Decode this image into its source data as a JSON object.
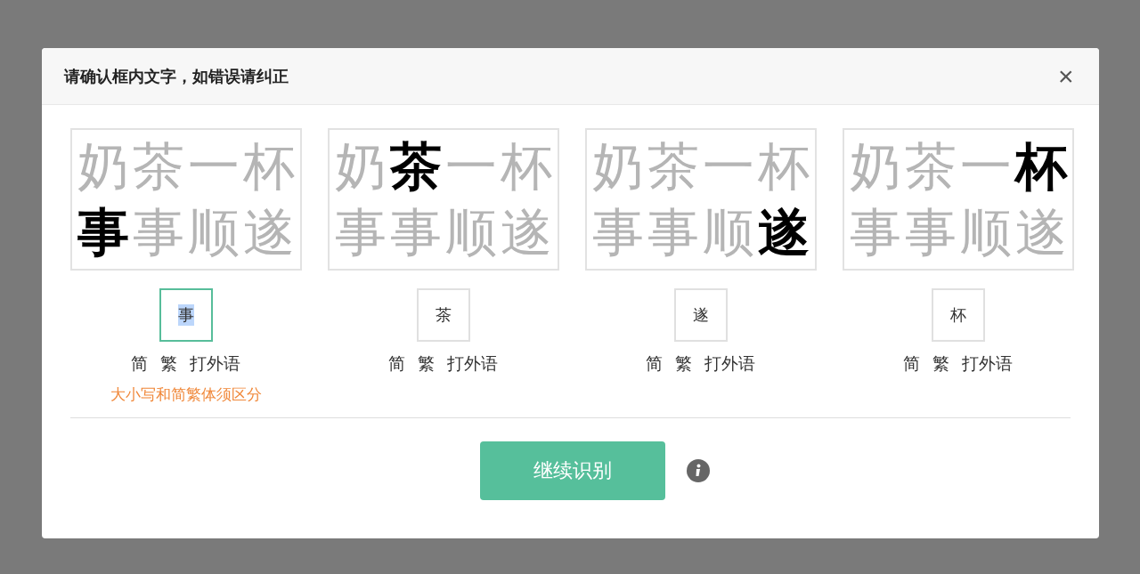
{
  "dialog": {
    "title": "请确认框内文字，如错误请纠正",
    "close_label": "×",
    "cards": [
      {
        "lines": [
          [
            {
              "char": "奶",
              "selected": false
            },
            {
              "char": "茶",
              "selected": false
            },
            {
              "char": "一",
              "selected": false
            },
            {
              "char": "杯",
              "selected": false
            }
          ],
          [
            {
              "char": "事",
              "selected": true
            },
            {
              "char": "事",
              "selected": false
            },
            {
              "char": "顺",
              "selected": false
            },
            {
              "char": "遂",
              "selected": false
            }
          ]
        ],
        "value": "事",
        "focused": true,
        "options": [
          "简",
          "繁",
          "打外语"
        ],
        "hint": "大小写和简繁体须区分"
      },
      {
        "lines": [
          [
            {
              "char": "奶",
              "selected": false
            },
            {
              "char": "茶",
              "selected": true
            },
            {
              "char": "一",
              "selected": false
            },
            {
              "char": "杯",
              "selected": false
            }
          ],
          [
            {
              "char": "事",
              "selected": false
            },
            {
              "char": "事",
              "selected": false
            },
            {
              "char": "顺",
              "selected": false
            },
            {
              "char": "遂",
              "selected": false
            }
          ]
        ],
        "value": "茶",
        "focused": false,
        "options": [
          "简",
          "繁",
          "打外语"
        ]
      },
      {
        "lines": [
          [
            {
              "char": "奶",
              "selected": false
            },
            {
              "char": "茶",
              "selected": false
            },
            {
              "char": "一",
              "selected": false
            },
            {
              "char": "杯",
              "selected": false
            }
          ],
          [
            {
              "char": "事",
              "selected": false
            },
            {
              "char": "事",
              "selected": false
            },
            {
              "char": "顺",
              "selected": false
            },
            {
              "char": "遂",
              "selected": true
            }
          ]
        ],
        "value": "遂",
        "focused": false,
        "options": [
          "简",
          "繁",
          "打外语"
        ]
      },
      {
        "lines": [
          [
            {
              "char": "奶",
              "selected": false
            },
            {
              "char": "茶",
              "selected": false
            },
            {
              "char": "一",
              "selected": false
            },
            {
              "char": "杯",
              "selected": true
            }
          ],
          [
            {
              "char": "事",
              "selected": false
            },
            {
              "char": "事",
              "selected": false
            },
            {
              "char": "顺",
              "selected": false
            },
            {
              "char": "遂",
              "selected": false
            }
          ]
        ],
        "value": "杯",
        "focused": false,
        "options": [
          "简",
          "繁",
          "打外语"
        ]
      }
    ],
    "button": "继续识别"
  }
}
